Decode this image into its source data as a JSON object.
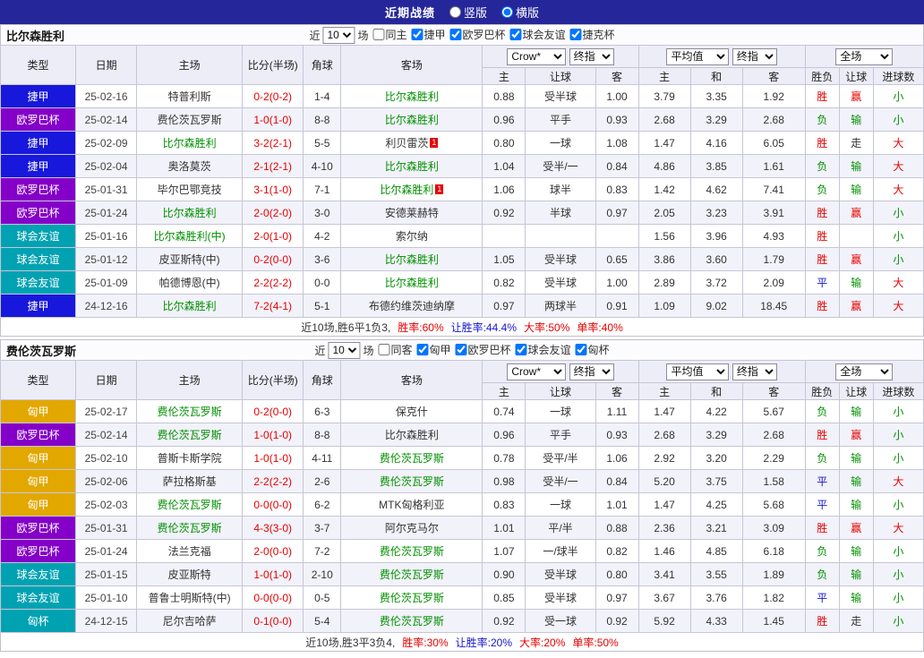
{
  "colors": {
    "r": "#E60000",
    "g": "#009000",
    "b": "#1515D0",
    "k": "#333333",
    "focus_team": "#009000",
    "score": "#E60000",
    "topbar_bg": "#26269B"
  },
  "league_colors": {
    "捷甲": "#1818DC",
    "欧罗巴杯": "#8400C8",
    "球会友谊": "#00A2B2",
    "匈甲": "#E2A800",
    "匈杯": "#00A2B2"
  },
  "topbar": {
    "title": "近期战绩",
    "vertical_label": "竖版",
    "horizontal_label": "横版"
  },
  "sections": [
    {
      "team": "比尔森胜利",
      "filter": {
        "near_label": "近",
        "count": "10",
        "games_label": "场",
        "options": [
          {
            "label": "同主",
            "checked": false
          },
          {
            "label": "捷甲",
            "checked": true
          },
          {
            "label": "欧罗巴杯",
            "checked": true
          },
          {
            "label": "球会友谊",
            "checked": true
          },
          {
            "label": "捷克杯",
            "checked": true
          }
        ]
      },
      "header": {
        "type": "类型",
        "date": "日期",
        "home": "主场",
        "score": "比分(半场)",
        "corner": "角球",
        "away": "客场",
        "company_select": "Crow*",
        "final_select": "终指",
        "avg_select": "平均值",
        "final_select2": "终指",
        "scope_select": "全场",
        "sub": [
          "主",
          "让球",
          "客",
          "主",
          "和",
          "客",
          "胜负",
          "让球",
          "进球数"
        ]
      },
      "rows": [
        {
          "league": "捷甲",
          "date": "25-02-16",
          "home": {
            "name": "特普利斯",
            "focus": false,
            "card": ""
          },
          "score": "0-2(0-2)",
          "corner": "1-4",
          "away": {
            "name": "比尔森胜利",
            "focus": true,
            "card": ""
          },
          "odds": [
            "0.88",
            "受半球",
            "1.00"
          ],
          "avg": [
            "3.79",
            "3.35",
            "1.92"
          ],
          "results": [
            {
              "text": "胜",
              "color": "r"
            },
            {
              "text": "赢",
              "color": "r"
            },
            {
              "text": "小",
              "color": "g"
            }
          ]
        },
        {
          "league": "欧罗巴杯",
          "date": "25-02-14",
          "home": {
            "name": "费伦茨瓦罗斯",
            "focus": false,
            "card": ""
          },
          "score": "1-0(1-0)",
          "corner": "8-8",
          "away": {
            "name": "比尔森胜利",
            "focus": true,
            "card": ""
          },
          "odds": [
            "0.96",
            "平手",
            "0.93"
          ],
          "avg": [
            "2.68",
            "3.29",
            "2.68"
          ],
          "results": [
            {
              "text": "负",
              "color": "g"
            },
            {
              "text": "输",
              "color": "g"
            },
            {
              "text": "小",
              "color": "g"
            }
          ]
        },
        {
          "league": "捷甲",
          "date": "25-02-09",
          "home": {
            "name": "比尔森胜利",
            "focus": true,
            "card": ""
          },
          "score": "3-2(2-1)",
          "corner": "5-5",
          "away": {
            "name": "利贝雷茨",
            "focus": false,
            "card": "1"
          },
          "odds": [
            "0.80",
            "一球",
            "1.08"
          ],
          "avg": [
            "1.47",
            "4.16",
            "6.05"
          ],
          "results": [
            {
              "text": "胜",
              "color": "r"
            },
            {
              "text": "走",
              "color": "k"
            },
            {
              "text": "大",
              "color": "r"
            }
          ]
        },
        {
          "league": "捷甲",
          "date": "25-02-04",
          "home": {
            "name": "奥洛莫茨",
            "focus": false,
            "card": ""
          },
          "score": "2-1(2-1)",
          "corner": "4-10",
          "away": {
            "name": "比尔森胜利",
            "focus": true,
            "card": ""
          },
          "odds": [
            "1.04",
            "受半/一",
            "0.84"
          ],
          "avg": [
            "4.86",
            "3.85",
            "1.61"
          ],
          "results": [
            {
              "text": "负",
              "color": "g"
            },
            {
              "text": "输",
              "color": "g"
            },
            {
              "text": "大",
              "color": "r"
            }
          ]
        },
        {
          "league": "欧罗巴杯",
          "date": "25-01-31",
          "home": {
            "name": "毕尔巴鄂竞技",
            "focus": false,
            "card": ""
          },
          "score": "3-1(1-0)",
          "corner": "7-1",
          "away": {
            "name": "比尔森胜利",
            "focus": true,
            "card": "1"
          },
          "odds": [
            "1.06",
            "球半",
            "0.83"
          ],
          "avg": [
            "1.42",
            "4.62",
            "7.41"
          ],
          "results": [
            {
              "text": "负",
              "color": "g"
            },
            {
              "text": "输",
              "color": "g"
            },
            {
              "text": "大",
              "color": "r"
            }
          ]
        },
        {
          "league": "欧罗巴杯",
          "date": "25-01-24",
          "home": {
            "name": "比尔森胜利",
            "focus": true,
            "card": ""
          },
          "score": "2-0(2-0)",
          "corner": "3-0",
          "away": {
            "name": "安德莱赫特",
            "focus": false,
            "card": ""
          },
          "odds": [
            "0.92",
            "半球",
            "0.97"
          ],
          "avg": [
            "2.05",
            "3.23",
            "3.91"
          ],
          "results": [
            {
              "text": "胜",
              "color": "r"
            },
            {
              "text": "赢",
              "color": "r"
            },
            {
              "text": "小",
              "color": "g"
            }
          ]
        },
        {
          "league": "球会友谊",
          "date": "25-01-16",
          "home": {
            "name": "比尔森胜利(中)",
            "focus": true,
            "card": ""
          },
          "score": "2-0(1-0)",
          "corner": "4-2",
          "away": {
            "name": "索尔纳",
            "focus": false,
            "card": ""
          },
          "odds": [
            "",
            "",
            ""
          ],
          "avg": [
            "1.56",
            "3.96",
            "4.93"
          ],
          "results": [
            {
              "text": "胜",
              "color": "r"
            },
            {
              "text": "",
              "color": "k"
            },
            {
              "text": "小",
              "color": "g"
            }
          ]
        },
        {
          "league": "球会友谊",
          "date": "25-01-12",
          "home": {
            "name": "皮亚斯特(中)",
            "focus": false,
            "card": ""
          },
          "score": "0-2(0-0)",
          "corner": "3-6",
          "away": {
            "name": "比尔森胜利",
            "focus": true,
            "card": ""
          },
          "odds": [
            "1.05",
            "受半球",
            "0.65"
          ],
          "avg": [
            "3.86",
            "3.60",
            "1.79"
          ],
          "results": [
            {
              "text": "胜",
              "color": "r"
            },
            {
              "text": "赢",
              "color": "r"
            },
            {
              "text": "小",
              "color": "g"
            }
          ]
        },
        {
          "league": "球会友谊",
          "date": "25-01-09",
          "home": {
            "name": "帕德博恩(中)",
            "focus": false,
            "card": ""
          },
          "score": "2-2(2-2)",
          "corner": "0-0",
          "away": {
            "name": "比尔森胜利",
            "focus": true,
            "card": ""
          },
          "odds": [
            "0.82",
            "受半球",
            "1.00"
          ],
          "avg": [
            "2.89",
            "3.72",
            "2.09"
          ],
          "results": [
            {
              "text": "平",
              "color": "b"
            },
            {
              "text": "输",
              "color": "g"
            },
            {
              "text": "大",
              "color": "r"
            }
          ]
        },
        {
          "league": "捷甲",
          "date": "24-12-16",
          "home": {
            "name": "比尔森胜利",
            "focus": true,
            "card": ""
          },
          "score": "7-2(4-1)",
          "corner": "5-1",
          "away": {
            "name": "布德约维茨迪纳摩",
            "focus": false,
            "card": ""
          },
          "odds": [
            "0.97",
            "两球半",
            "0.91"
          ],
          "avg": [
            "1.09",
            "9.02",
            "18.45"
          ],
          "results": [
            {
              "text": "胜",
              "color": "r"
            },
            {
              "text": "赢",
              "color": "r"
            },
            {
              "text": "大",
              "color": "r"
            }
          ]
        }
      ],
      "summary": [
        {
          "text": "近10场,胜6平1负3,",
          "color": "k"
        },
        {
          "text": "胜率:60%",
          "color": "r"
        },
        {
          "text": "让胜率:44.4%",
          "color": "b"
        },
        {
          "text": "大率:50%",
          "color": "r"
        },
        {
          "text": "单率:40%",
          "color": "r"
        }
      ]
    },
    {
      "team": "费伦茨瓦罗斯",
      "filter": {
        "near_label": "近",
        "count": "10",
        "games_label": "场",
        "options": [
          {
            "label": "同客",
            "checked": false
          },
          {
            "label": "匈甲",
            "checked": true
          },
          {
            "label": "欧罗巴杯",
            "checked": true
          },
          {
            "label": "球会友谊",
            "checked": true
          },
          {
            "label": "匈杯",
            "checked": true
          }
        ]
      },
      "header": {
        "type": "类型",
        "date": "日期",
        "home": "主场",
        "score": "比分(半场)",
        "corner": "角球",
        "away": "客场",
        "company_select": "Crow*",
        "final_select": "终指",
        "avg_select": "平均值",
        "final_select2": "终指",
        "scope_select": "全场",
        "sub": [
          "主",
          "让球",
          "客",
          "主",
          "和",
          "客",
          "胜负",
          "让球",
          "进球数"
        ]
      },
      "rows": [
        {
          "league": "匈甲",
          "date": "25-02-17",
          "home": {
            "name": "费伦茨瓦罗斯",
            "focus": true,
            "card": ""
          },
          "score": "0-2(0-0)",
          "corner": "6-3",
          "away": {
            "name": "保克什",
            "focus": false,
            "card": ""
          },
          "odds": [
            "0.74",
            "一球",
            "1.11"
          ],
          "avg": [
            "1.47",
            "4.22",
            "5.67"
          ],
          "results": [
            {
              "text": "负",
              "color": "g"
            },
            {
              "text": "输",
              "color": "g"
            },
            {
              "text": "小",
              "color": "g"
            }
          ]
        },
        {
          "league": "欧罗巴杯",
          "date": "25-02-14",
          "home": {
            "name": "费伦茨瓦罗斯",
            "focus": true,
            "card": ""
          },
          "score": "1-0(1-0)",
          "corner": "8-8",
          "away": {
            "name": "比尔森胜利",
            "focus": false,
            "card": ""
          },
          "odds": [
            "0.96",
            "平手",
            "0.93"
          ],
          "avg": [
            "2.68",
            "3.29",
            "2.68"
          ],
          "results": [
            {
              "text": "胜",
              "color": "r"
            },
            {
              "text": "赢",
              "color": "r"
            },
            {
              "text": "小",
              "color": "g"
            }
          ]
        },
        {
          "league": "匈甲",
          "date": "25-02-10",
          "home": {
            "name": "普斯卡斯学院",
            "focus": false,
            "card": ""
          },
          "score": "1-0(1-0)",
          "corner": "4-11",
          "away": {
            "name": "费伦茨瓦罗斯",
            "focus": true,
            "card": ""
          },
          "odds": [
            "0.78",
            "受平/半",
            "1.06"
          ],
          "avg": [
            "2.92",
            "3.20",
            "2.29"
          ],
          "results": [
            {
              "text": "负",
              "color": "g"
            },
            {
              "text": "输",
              "color": "g"
            },
            {
              "text": "小",
              "color": "g"
            }
          ]
        },
        {
          "league": "匈甲",
          "date": "25-02-06",
          "home": {
            "name": "萨拉格斯基",
            "focus": false,
            "card": ""
          },
          "score": "2-2(2-2)",
          "corner": "2-6",
          "away": {
            "name": "费伦茨瓦罗斯",
            "focus": true,
            "card": ""
          },
          "odds": [
            "0.98",
            "受半/一",
            "0.84"
          ],
          "avg": [
            "5.20",
            "3.75",
            "1.58"
          ],
          "results": [
            {
              "text": "平",
              "color": "b"
            },
            {
              "text": "输",
              "color": "g"
            },
            {
              "text": "大",
              "color": "r"
            }
          ]
        },
        {
          "league": "匈甲",
          "date": "25-02-03",
          "home": {
            "name": "费伦茨瓦罗斯",
            "focus": true,
            "card": ""
          },
          "score": "0-0(0-0)",
          "corner": "6-2",
          "away": {
            "name": "MTK匈格利亚",
            "focus": false,
            "card": ""
          },
          "odds": [
            "0.83",
            "一球",
            "1.01"
          ],
          "avg": [
            "1.47",
            "4.25",
            "5.68"
          ],
          "results": [
            {
              "text": "平",
              "color": "b"
            },
            {
              "text": "输",
              "color": "g"
            },
            {
              "text": "小",
              "color": "g"
            }
          ]
        },
        {
          "league": "欧罗巴杯",
          "date": "25-01-31",
          "home": {
            "name": "费伦茨瓦罗斯",
            "focus": true,
            "card": ""
          },
          "score": "4-3(3-0)",
          "corner": "3-7",
          "away": {
            "name": "阿尔克马尔",
            "focus": false,
            "card": ""
          },
          "odds": [
            "1.01",
            "平/半",
            "0.88"
          ],
          "avg": [
            "2.36",
            "3.21",
            "3.09"
          ],
          "results": [
            {
              "text": "胜",
              "color": "r"
            },
            {
              "text": "赢",
              "color": "r"
            },
            {
              "text": "大",
              "color": "r"
            }
          ]
        },
        {
          "league": "欧罗巴杯",
          "date": "25-01-24",
          "home": {
            "name": "法兰克福",
            "focus": false,
            "card": ""
          },
          "score": "2-0(0-0)",
          "corner": "7-2",
          "away": {
            "name": "费伦茨瓦罗斯",
            "focus": true,
            "card": ""
          },
          "odds": [
            "1.07",
            "一/球半",
            "0.82"
          ],
          "avg": [
            "1.46",
            "4.85",
            "6.18"
          ],
          "results": [
            {
              "text": "负",
              "color": "g"
            },
            {
              "text": "输",
              "color": "g"
            },
            {
              "text": "小",
              "color": "g"
            }
          ]
        },
        {
          "league": "球会友谊",
          "date": "25-01-15",
          "home": {
            "name": "皮亚斯特",
            "focus": false,
            "card": ""
          },
          "score": "1-0(1-0)",
          "corner": "2-10",
          "away": {
            "name": "费伦茨瓦罗斯",
            "focus": true,
            "card": ""
          },
          "odds": [
            "0.90",
            "受半球",
            "0.80"
          ],
          "avg": [
            "3.41",
            "3.55",
            "1.89"
          ],
          "results": [
            {
              "text": "负",
              "color": "g"
            },
            {
              "text": "输",
              "color": "g"
            },
            {
              "text": "小",
              "color": "g"
            }
          ]
        },
        {
          "league": "球会友谊",
          "date": "25-01-10",
          "home": {
            "name": "普鲁士明斯特(中)",
            "focus": false,
            "card": ""
          },
          "score": "0-0(0-0)",
          "corner": "0-5",
          "away": {
            "name": "费伦茨瓦罗斯",
            "focus": true,
            "card": ""
          },
          "odds": [
            "0.85",
            "受半球",
            "0.97"
          ],
          "avg": [
            "3.67",
            "3.76",
            "1.82"
          ],
          "results": [
            {
              "text": "平",
              "color": "b"
            },
            {
              "text": "输",
              "color": "g"
            },
            {
              "text": "小",
              "color": "g"
            }
          ]
        },
        {
          "league": "匈杯",
          "date": "24-12-15",
          "home": {
            "name": "尼尔吉哈萨",
            "focus": false,
            "card": ""
          },
          "score": "0-1(0-0)",
          "corner": "5-4",
          "away": {
            "name": "费伦茨瓦罗斯",
            "focus": true,
            "card": ""
          },
          "odds": [
            "0.92",
            "受一球",
            "0.92"
          ],
          "avg": [
            "5.92",
            "4.33",
            "1.45"
          ],
          "results": [
            {
              "text": "胜",
              "color": "r"
            },
            {
              "text": "走",
              "color": "k"
            },
            {
              "text": "小",
              "color": "g"
            }
          ]
        }
      ],
      "summary": [
        {
          "text": "近10场,胜3平3负4,",
          "color": "k"
        },
        {
          "text": "胜率:30%",
          "color": "r"
        },
        {
          "text": "让胜率:20%",
          "color": "b"
        },
        {
          "text": "大率:20%",
          "color": "r"
        },
        {
          "text": "单率:50%",
          "color": "r"
        }
      ]
    }
  ]
}
